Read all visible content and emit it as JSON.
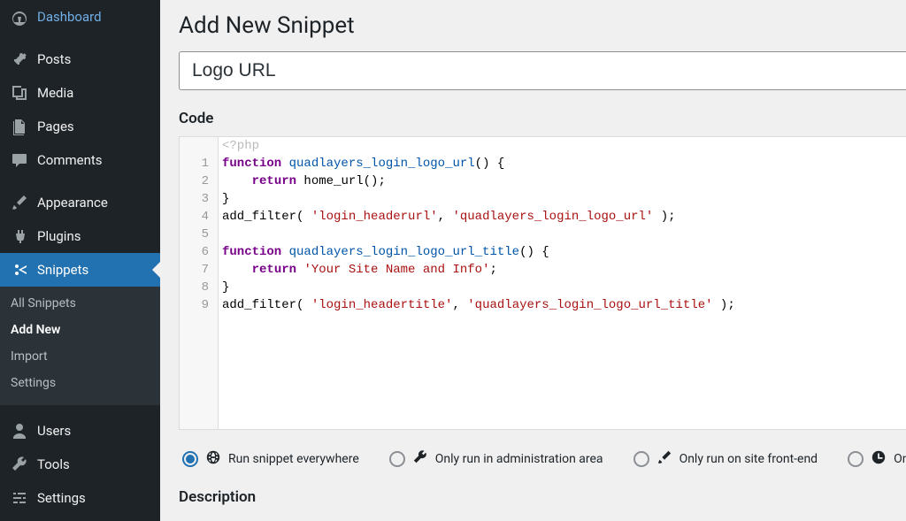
{
  "sidebar": {
    "items": [
      {
        "label": "Dashboard",
        "icon": "dashboard"
      },
      {
        "label": "Posts",
        "icon": "pin"
      },
      {
        "label": "Media",
        "icon": "media"
      },
      {
        "label": "Pages",
        "icon": "pages"
      },
      {
        "label": "Comments",
        "icon": "comment"
      },
      {
        "label": "Appearance",
        "icon": "brush"
      },
      {
        "label": "Plugins",
        "icon": "plug"
      },
      {
        "label": "Snippets",
        "icon": "scissors",
        "current": true
      },
      {
        "label": "Users",
        "icon": "user"
      },
      {
        "label": "Tools",
        "icon": "wrench"
      },
      {
        "label": "Settings",
        "icon": "sliders"
      }
    ],
    "submenu": [
      {
        "label": "All Snippets"
      },
      {
        "label": "Add New",
        "current": true
      },
      {
        "label": "Import"
      },
      {
        "label": "Settings"
      }
    ]
  },
  "page": {
    "title": "Add New Snippet",
    "snippet_title": "Logo URL",
    "code_label": "Code",
    "description_label": "Description"
  },
  "code": {
    "open_tag": "<?php",
    "lines": [
      [
        {
          "t": "function ",
          "c": "kw"
        },
        {
          "t": "quadlayers_login_logo_url",
          "c": "fn"
        },
        {
          "t": "() {",
          "c": ""
        }
      ],
      [
        {
          "t": "    ",
          "c": ""
        },
        {
          "t": "return",
          "c": "kw"
        },
        {
          "t": " home_url();",
          "c": ""
        }
      ],
      [
        {
          "t": "}",
          "c": ""
        }
      ],
      [
        {
          "t": "add_filter( ",
          "c": ""
        },
        {
          "t": "'login_headerurl'",
          "c": "str"
        },
        {
          "t": ", ",
          "c": ""
        },
        {
          "t": "'quadlayers_login_logo_url'",
          "c": "str"
        },
        {
          "t": " );",
          "c": ""
        }
      ],
      [],
      [
        {
          "t": "function ",
          "c": "kw"
        },
        {
          "t": "quadlayers_login_logo_url_title",
          "c": "fn"
        },
        {
          "t": "() {",
          "c": ""
        }
      ],
      [
        {
          "t": "    ",
          "c": ""
        },
        {
          "t": "return",
          "c": "kw"
        },
        {
          "t": " ",
          "c": ""
        },
        {
          "t": "'Your Site Name and Info'",
          "c": "str"
        },
        {
          "t": ";",
          "c": ""
        }
      ],
      [
        {
          "t": "}",
          "c": ""
        }
      ],
      [
        {
          "t": "add_filter( ",
          "c": ""
        },
        {
          "t": "'login_headertitle'",
          "c": "str"
        },
        {
          "t": ", ",
          "c": ""
        },
        {
          "t": "'quadlayers_login_logo_url_title'",
          "c": "str"
        },
        {
          "t": " );",
          "c": ""
        }
      ]
    ]
  },
  "scopes": [
    {
      "label": "Run snippet everywhere",
      "icon": "globe",
      "checked": true
    },
    {
      "label": "Only run in administration area",
      "icon": "wrench",
      "checked": false
    },
    {
      "label": "Only run on site front-end",
      "icon": "brush",
      "checked": false
    },
    {
      "label": "Only",
      "icon": "clock",
      "checked": false
    }
  ]
}
